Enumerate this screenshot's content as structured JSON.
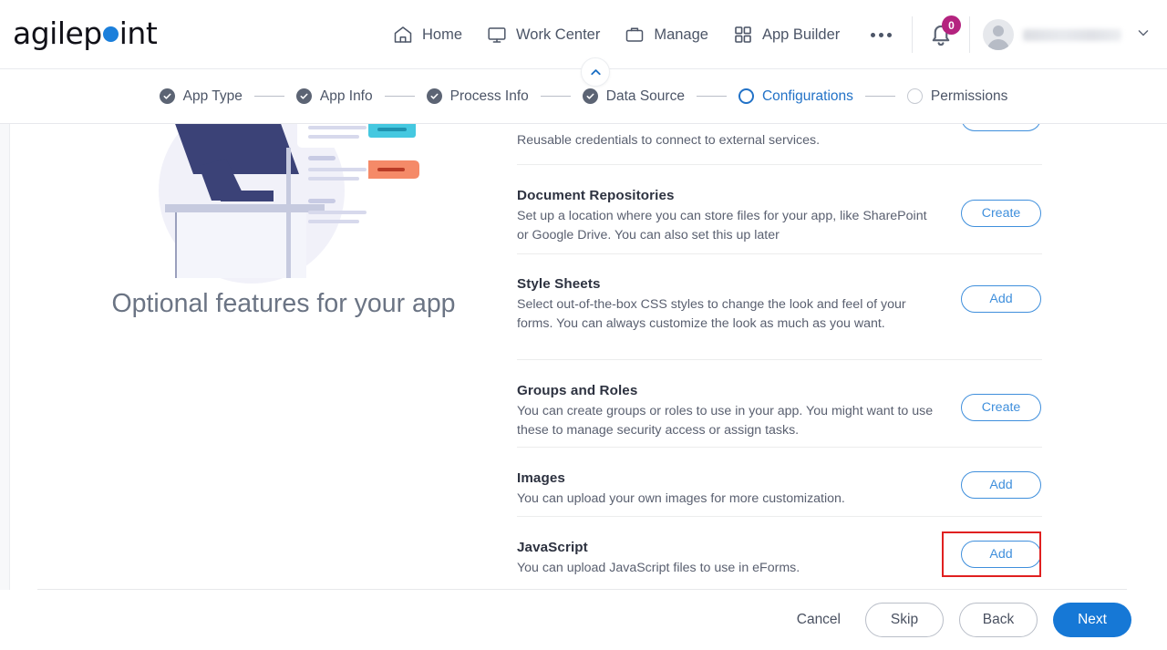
{
  "brand": {
    "name_before": "agilep",
    "name_after": "int",
    "dot_color": "#1b7fdb"
  },
  "nav": {
    "items": [
      {
        "label": "Home",
        "icon": "home-icon"
      },
      {
        "label": "Work Center",
        "icon": "monitor-icon"
      },
      {
        "label": "Manage",
        "icon": "briefcase-icon"
      },
      {
        "label": "App Builder",
        "icon": "grid-icon"
      }
    ],
    "more_label": "more-options-icon"
  },
  "topright": {
    "notification_count": "0",
    "notification_color": "#b4237f",
    "username": ""
  },
  "stepper": {
    "steps": [
      {
        "label": "App Type",
        "state": "done"
      },
      {
        "label": "App Info",
        "state": "done"
      },
      {
        "label": "Process Info",
        "state": "done"
      },
      {
        "label": "Data Source",
        "state": "done"
      },
      {
        "label": "Configurations",
        "state": "active"
      },
      {
        "label": "Permissions",
        "state": "todo"
      }
    ],
    "active_color": "#2272c7"
  },
  "left_panel": {
    "heading": "Optional features for your app"
  },
  "features": [
    {
      "title": "",
      "desc": "Reusable credentials to connect to external services.",
      "button": "",
      "partial": true
    },
    {
      "title": "Document Repositories",
      "desc": "Set up a location where you can store files for your app, like SharePoint or Google Drive. You can also set this up later",
      "button": "Create",
      "partial": false
    },
    {
      "title": "Style Sheets",
      "desc": "Select out-of-the-box CSS styles to change the look and feel of your forms. You can always customize the look as much as you want.",
      "button": "Add",
      "partial": false
    },
    {
      "title": "Groups and Roles",
      "desc": "You can create groups or roles to use in your app. You might want to use these to manage security access or assign tasks.",
      "button": "Create",
      "partial": false
    },
    {
      "title": "Images",
      "desc": "You can upload your own images for more customization.",
      "button": "Add",
      "partial": false
    },
    {
      "title": "JavaScript",
      "desc": "You can upload JavaScript files to use in eForms.",
      "button": "Add",
      "partial": false,
      "highlighted": true
    }
  ],
  "footer": {
    "cancel": "Cancel",
    "skip": "Skip",
    "back": "Back",
    "next": "Next",
    "primary_color": "#1678d6"
  }
}
